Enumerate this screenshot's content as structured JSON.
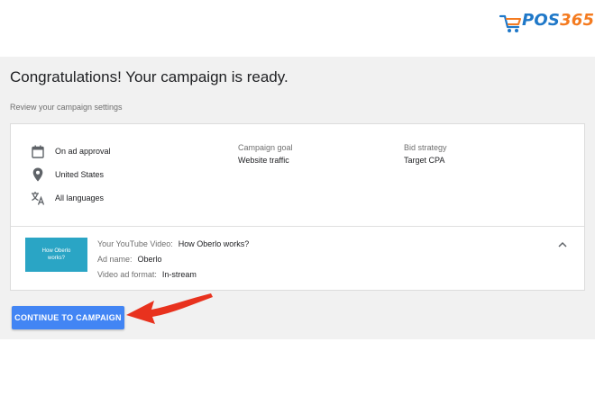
{
  "brand": {
    "logo_pos": "POS",
    "logo_num": "365"
  },
  "page": {
    "title": "Congratulations! Your campaign is ready.",
    "subtitle": "Review your campaign settings"
  },
  "settings": {
    "schedule": {
      "icon": "calendar-icon",
      "label": "On ad approval"
    },
    "location": {
      "icon": "location-pin-icon",
      "label": "United States"
    },
    "language": {
      "icon": "translate-icon",
      "label": "All languages"
    }
  },
  "goal": {
    "label": "Campaign goal",
    "value": "Website traffic"
  },
  "bid": {
    "label": "Bid strategy",
    "value": "Target CPA"
  },
  "ad": {
    "thumbnail_text": [
      "How Oberlo",
      "works?"
    ],
    "video_label": "Your YouTube Video:",
    "video_value": "How Oberlo works?",
    "name_label": "Ad name:",
    "name_value": "Oberlo",
    "format_label": "Video ad format:",
    "format_value": "In-stream"
  },
  "actions": {
    "continue_label": "CONTINUE TO CAMPAIGN"
  },
  "colors": {
    "primary": "#4285f4",
    "arrow": "#e8321e",
    "thumbnail": "#2aa5c5",
    "panel": "#f1f1f1"
  }
}
